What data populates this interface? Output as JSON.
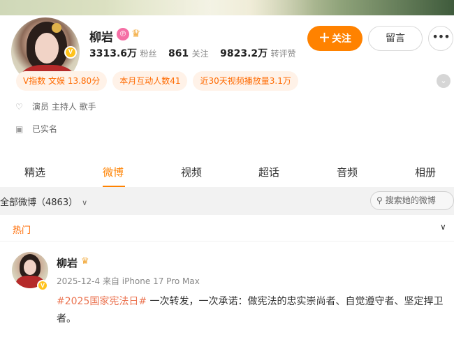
{
  "profile": {
    "name": "柳岩",
    "verified_badge": "V",
    "stats": [
      {
        "value": "3313.6万",
        "label": "粉丝"
      },
      {
        "value": "861",
        "label": "关注"
      },
      {
        "value": "9823.2万",
        "label": "转评赞"
      }
    ],
    "actions": {
      "follow": "关注",
      "message": "留言",
      "more": "•••"
    },
    "tags": [
      "V指数 文娱 13.80分",
      "本月互动人数41",
      "近30天视频播放量3.1万"
    ],
    "info": [
      {
        "icon": "badge-icon",
        "text": "演员 主持人 歌手"
      },
      {
        "icon": "id-card-icon",
        "text": "已实名"
      }
    ]
  },
  "tabs": [
    "精选",
    "微博",
    "视频",
    "超话",
    "音频",
    "相册"
  ],
  "active_tab": "微博",
  "filter": {
    "label": "全部微博（4863）",
    "search_placeholder": "搜索她的微博"
  },
  "section": {
    "label": "热门"
  },
  "post": {
    "author": "柳岩",
    "date": "2025-12-4",
    "source": "来自 iPhone 17 Pro Max",
    "topic": "#2025国家宪法日#",
    "text": " 一次转发，一次承诺：做宪法的忠实崇尚者、自觉遵守者、坚定捍卫者。"
  },
  "colors": {
    "accent": "#ff8200",
    "tag_text": "#ff6a00",
    "tag_bg": "#fff2e8",
    "topic": "#eb7350"
  }
}
